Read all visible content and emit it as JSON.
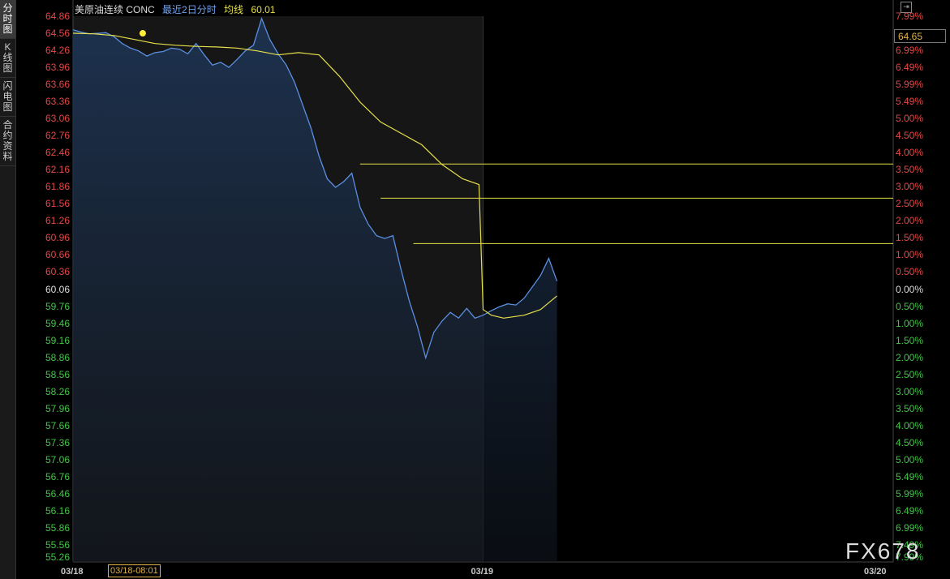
{
  "sidebar": {
    "tabs": [
      {
        "label": "分时图",
        "active": true
      },
      {
        "label": "K线图",
        "active": false
      },
      {
        "label": "闪电图",
        "active": false
      },
      {
        "label": "合约资料",
        "active": false
      }
    ]
  },
  "header": {
    "name": "美原油连续 CONC",
    "mode": "最近2日分时",
    "avg_label": "均线",
    "avg_value": "60.01"
  },
  "current_price": "64.65",
  "watermark": "FX678",
  "crosshair_time": "03/18-08:01",
  "colors": {
    "price_line": "#5b8fe0",
    "avg_line": "#e6e04a",
    "up": "#e84646",
    "down": "#3fc845",
    "neutral": "#dddddd"
  },
  "chart_data": {
    "type": "line",
    "title": "",
    "xlabel": "",
    "ylabel": "",
    "ylim": [
      55.26,
      64.86
    ],
    "base_price": 60.06,
    "left_ticks": [
      "64.86",
      "64.56",
      "64.26",
      "63.96",
      "63.66",
      "63.36",
      "63.06",
      "62.76",
      "62.46",
      "62.16",
      "61.86",
      "61.56",
      "61.26",
      "60.96",
      "60.66",
      "60.36",
      "60.06",
      "59.76",
      "59.46",
      "59.16",
      "58.86",
      "58.56",
      "58.26",
      "57.96",
      "57.66",
      "57.36",
      "57.06",
      "56.76",
      "56.46",
      "56.16",
      "55.86",
      "55.56",
      "55.26"
    ],
    "right_ticks": [
      "7.99%",
      "7.49%",
      "6.99%",
      "6.49%",
      "5.99%",
      "5.49%",
      "5.00%",
      "4.50%",
      "4.00%",
      "3.50%",
      "3.00%",
      "2.50%",
      "2.00%",
      "1.50%",
      "1.00%",
      "0.50%",
      "0.00%",
      "0.50%",
      "1.00%",
      "1.50%",
      "2.00%",
      "2.50%",
      "3.00%",
      "3.50%",
      "4.00%",
      "4.50%",
      "5.00%",
      "5.49%",
      "5.99%",
      "6.49%",
      "6.99%",
      "7.49%",
      "7.99%"
    ],
    "x_ticks": [
      "03/18",
      "03/19",
      "03/20"
    ],
    "x_range": [
      0,
      2
    ],
    "horizontal_levels": [
      {
        "from_x": 0.7,
        "y": 62.26
      },
      {
        "from_x": 0.75,
        "y": 61.66
      },
      {
        "from_x": 0.83,
        "y": 60.86
      }
    ],
    "series": [
      {
        "kind": "price",
        "x": [
          0,
          0.02,
          0.04,
          0.06,
          0.08,
          0.1,
          0.12,
          0.14,
          0.16,
          0.18,
          0.2,
          0.22,
          0.24,
          0.26,
          0.28,
          0.3,
          0.32,
          0.34,
          0.36,
          0.38,
          0.4,
          0.42,
          0.44,
          0.46,
          0.48,
          0.5,
          0.52,
          0.54,
          0.56,
          0.58,
          0.6,
          0.62,
          0.64,
          0.66,
          0.68,
          0.7,
          0.72,
          0.74,
          0.76,
          0.78,
          0.8,
          0.82,
          0.84,
          0.86,
          0.88,
          0.9,
          0.92,
          0.94,
          0.96,
          0.98,
          1.0,
          1.02,
          1.04,
          1.06,
          1.08,
          1.1,
          1.12,
          1.14,
          1.16,
          1.18
        ],
        "y": [
          64.62,
          64.58,
          64.55,
          64.56,
          64.57,
          64.5,
          64.38,
          64.3,
          64.25,
          64.16,
          64.22,
          64.24,
          64.3,
          64.28,
          64.2,
          64.38,
          64.18,
          64.0,
          64.05,
          63.96,
          64.1,
          64.25,
          64.35,
          64.82,
          64.45,
          64.2,
          64.0,
          63.7,
          63.3,
          62.9,
          62.4,
          62.0,
          61.85,
          61.95,
          62.1,
          61.5,
          61.2,
          61.0,
          60.95,
          61.0,
          60.4,
          59.85,
          59.4,
          58.85,
          59.3,
          59.5,
          59.65,
          59.55,
          59.72,
          59.55,
          59.6,
          59.68,
          59.75,
          59.8,
          59.78,
          59.9,
          60.1,
          60.3,
          60.6,
          60.2
        ]
      },
      {
        "kind": "average",
        "x": [
          0,
          0.05,
          0.1,
          0.15,
          0.2,
          0.25,
          0.3,
          0.35,
          0.4,
          0.45,
          0.5,
          0.55,
          0.6,
          0.65,
          0.7,
          0.75,
          0.8,
          0.85,
          0.9,
          0.95,
          0.99,
          1.0,
          1.02,
          1.05,
          1.08,
          1.1,
          1.14,
          1.18
        ],
        "y": [
          64.56,
          64.55,
          64.52,
          64.45,
          64.38,
          64.35,
          64.33,
          64.32,
          64.3,
          64.25,
          64.18,
          64.22,
          64.18,
          63.8,
          63.35,
          63.0,
          62.8,
          62.6,
          62.25,
          62.0,
          61.9,
          59.7,
          59.6,
          59.55,
          59.58,
          59.6,
          59.7,
          59.94
        ]
      }
    ]
  }
}
